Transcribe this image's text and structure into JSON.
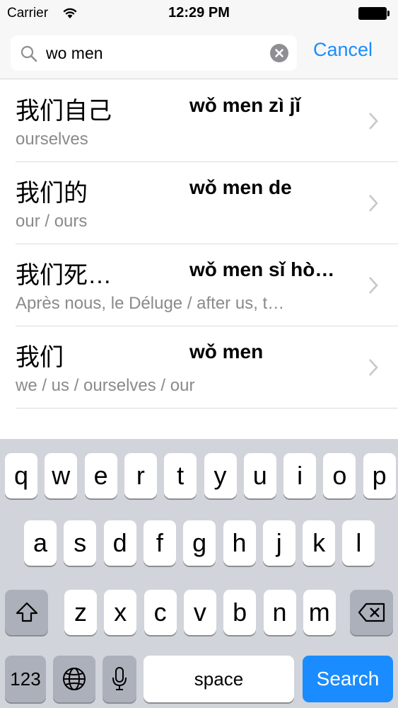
{
  "status_bar": {
    "carrier": "Carrier",
    "time": "12:29 PM"
  },
  "search": {
    "query": "wo men",
    "cancel_label": "Cancel"
  },
  "results": [
    {
      "hanzi": "我们自己",
      "pinyin": "wǒ men zì jǐ",
      "meaning": "ourselves"
    },
    {
      "hanzi": "我们的",
      "pinyin": "wǒ men de",
      "meaning": "our / ours"
    },
    {
      "hanzi": "我们死…",
      "pinyin": "wǒ men sǐ hò…",
      "meaning": "Après nous, le Déluge / after us, t…"
    },
    {
      "hanzi": "我们",
      "pinyin": "wǒ men",
      "meaning": "we / us / ourselves / our"
    }
  ],
  "keyboard": {
    "row1": [
      "q",
      "w",
      "e",
      "r",
      "t",
      "y",
      "u",
      "i",
      "o",
      "p"
    ],
    "row2": [
      "a",
      "s",
      "d",
      "f",
      "g",
      "h",
      "j",
      "k",
      "l"
    ],
    "row3": [
      "z",
      "x",
      "c",
      "v",
      "b",
      "n",
      "m"
    ],
    "numbers_label": "123",
    "space_label": "space",
    "search_label": "Search",
    "icons": [
      "shift-icon",
      "delete-icon",
      "globe-icon",
      "microphone-icon"
    ]
  },
  "colors": {
    "accent": "#1a8cff",
    "keyboard_bg": "#d1d4da",
    "secondary_text": "#8a8a8a"
  }
}
